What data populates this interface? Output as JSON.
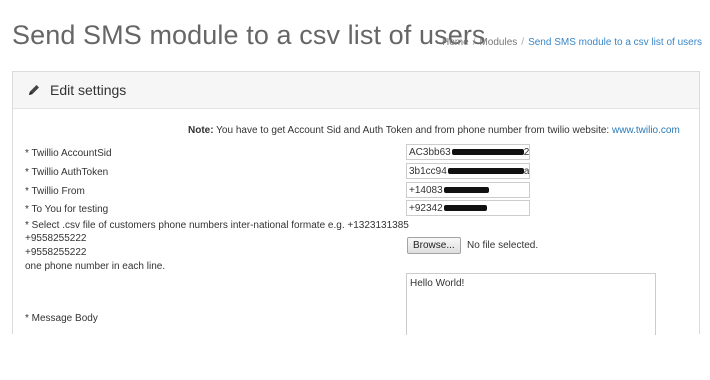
{
  "header": {
    "title": "Send SMS module to a csv list of users",
    "breadcrumb": [
      "Home",
      "Modules",
      "Send SMS module to a csv list of users"
    ]
  },
  "panel": {
    "heading": "Edit settings",
    "heading_icon": "pencil-icon",
    "note_label": "Note:",
    "note_text": "You have to get Account Sid and Auth Token and from phone number from twilio website:",
    "note_link": "www.twilio.com"
  },
  "form": {
    "account_sid": {
      "label": "* Twillio AccountSid",
      "value": "AC3bb63",
      "tail": "2"
    },
    "auth_token": {
      "label": "* Twillio AuthToken",
      "value": "3b1cc94",
      "tail": "a"
    },
    "from": {
      "label": "* Twillio From",
      "value": "+14083"
    },
    "to": {
      "label": "* To You for testing",
      "value": "+92342"
    },
    "csv": {
      "label_lines": [
        "* Select .csv file of customers phone numbers inter-national formate e.g. +1323131385",
        "+9558255222",
        "+9558255222",
        "one phone number in each line."
      ],
      "browse_label": "Browse...",
      "no_file": "No file selected."
    },
    "message": {
      "label": "* Message Body",
      "value": "Hello World!"
    }
  },
  "colors": {
    "link": "#2a7ab8",
    "title": "#666666",
    "panel_heading_bg": "#f6f6f6"
  }
}
